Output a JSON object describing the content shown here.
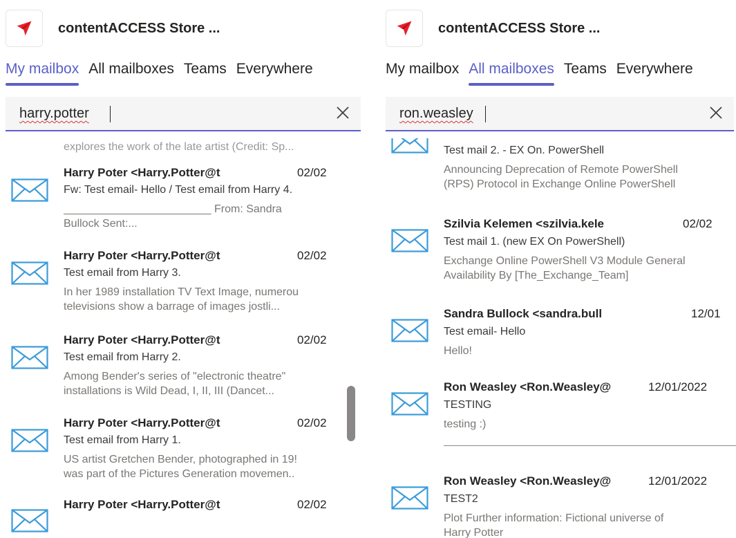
{
  "left": {
    "app_title": "contentACCESS Store ...",
    "tabs": [
      "My mailbox",
      "All mailboxes",
      "Teams",
      "Everywhere"
    ],
    "active_tab": "My mailbox",
    "search_value": "harry.potter",
    "cut_top_preview": "explores the work of the late artist (Credit: Sp...",
    "items": [
      {
        "sender": "Harry Poter <Harry.Potter@t",
        "date": "02/02",
        "subject": "Fw: Test email- Hello / Test email from Harry 4.",
        "preview": [
          "________________________ From: Sandra",
          "Bullock Sent:..."
        ]
      },
      {
        "sender": "Harry Poter <Harry.Potter@t",
        "date": "02/02",
        "subject": "Test email from Harry 3.",
        "preview": [
          "In her 1989 installation TV Text Image, numerou",
          "televisions show a barrage of images jostli..."
        ]
      },
      {
        "sender": "Harry Poter <Harry.Potter@t",
        "date": "02/02",
        "subject": "Test email from Harry 2.",
        "preview": [
          "Among Bender's series of \"electronic theatre\"",
          "installations is Wild Dead, I, II, III (Dancet..."
        ]
      },
      {
        "sender": "Harry Poter <Harry.Potter@t",
        "date": "02/02",
        "subject": "Test email from Harry 1.",
        "preview": [
          "US artist Gretchen Bender, photographed in 19!",
          "was part of the Pictures Generation movemen.."
        ]
      },
      {
        "sender": "Harry Poter <Harry.Potter@t",
        "date": "02/02",
        "subject": "",
        "preview": []
      }
    ]
  },
  "right": {
    "app_title": "contentACCESS Store ...",
    "tabs": [
      "My mailbox",
      "All mailboxes",
      "Teams",
      "Everywhere"
    ],
    "active_tab": "All mailboxes",
    "search_value": "ron.weasley",
    "items": [
      {
        "sender": "",
        "date": "",
        "subject": "Test mail 2. - EX On. PowerShell",
        "preview": [
          "Announcing Deprecation of Remote PowerShell",
          "(RPS) Protocol in Exchange Online PowerShell"
        ]
      },
      {
        "sender": "Szilvia Kelemen <szilvia.kele",
        "date": "02/02",
        "subject": "Test mail 1. (new EX On PowerShell)",
        "preview": [
          "Exchange Online PowerShell V3 Module General",
          "Availability By [The_Exchange_Team]"
        ]
      },
      {
        "sender": "Sandra Bullock <sandra.bull",
        "date": "12/01",
        "subject": "Test email- Hello",
        "preview": [
          "Hello!"
        ]
      },
      {
        "sender": "Ron Weasley <Ron.Weasley@",
        "date": "12/01/2022",
        "subject": "TESTING",
        "preview": [
          "testing :)"
        ]
      },
      {
        "sender": "Ron Weasley <Ron.Weasley@",
        "date": "12/01/2022",
        "subject": "TEST2",
        "preview": [
          "Plot Further information: Fictional universe of",
          "Harry Potter"
        ]
      }
    ]
  },
  "colors": {
    "accent": "#5b5fc7",
    "envelope": "#3b9bd9",
    "logo_red": "#e8202a"
  },
  "icons": [
    "app-logo-icon",
    "close-icon",
    "envelope-icon"
  ]
}
